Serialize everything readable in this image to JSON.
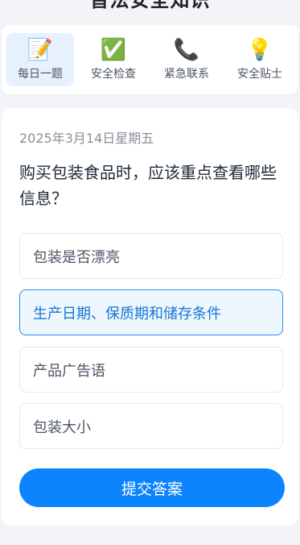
{
  "header": {
    "title": "普法安全知识"
  },
  "nav": {
    "items": [
      {
        "icon": "memo-icon",
        "glyph": "📝",
        "label": "每日一题",
        "active": true
      },
      {
        "icon": "check-mark-icon",
        "glyph": "✅",
        "label": "安全检查",
        "active": false
      },
      {
        "icon": "telephone-icon",
        "glyph": "📞",
        "label": "紧急联系",
        "active": false
      },
      {
        "icon": "light-bulb-icon",
        "glyph": "💡",
        "label": "安全贴士",
        "active": false
      }
    ]
  },
  "quiz": {
    "date": "2025年3月14日星期五",
    "question": "购买包装食品时，应该重点查看哪些信息？",
    "options": [
      {
        "label": "包装是否漂亮",
        "selected": false
      },
      {
        "label": "生产日期、保质期和储存条件",
        "selected": true
      },
      {
        "label": "产品广告语",
        "selected": false
      },
      {
        "label": "包装大小",
        "selected": false
      }
    ],
    "submit_label": "提交答案"
  },
  "colors": {
    "accent": "#0b84fe",
    "selected_border": "#2d8cf0",
    "selected_bg": "#eef6fe",
    "active_tab_bg": "#e6f1fd",
    "page_bg": "#f2f4f7"
  }
}
